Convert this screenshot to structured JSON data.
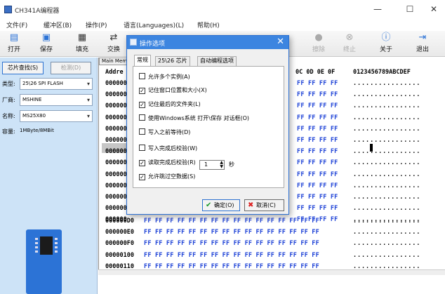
{
  "window": {
    "title": "CH341A编程器",
    "controls": [
      "—",
      "☐",
      "✕"
    ]
  },
  "menu": [
    "文件(F)",
    "缓冲区(B)",
    "操作(P)",
    "语言(Languages)(L)",
    "帮助(H)"
  ],
  "toolbar": [
    {
      "label": "打开",
      "icon": "folder-open-icon",
      "enabled": true
    },
    {
      "label": "保存",
      "icon": "save-icon",
      "enabled": true
    },
    {
      "label": "填充",
      "icon": "fill-icon",
      "enabled": true
    },
    {
      "label": "交换",
      "icon": "swap-icon",
      "enabled": true
    },
    {
      "label": "擦除",
      "icon": "erase-icon",
      "enabled": false
    },
    {
      "label": "终止",
      "icon": "stop-icon",
      "enabled": false
    },
    {
      "label": "关于",
      "icon": "info-icon",
      "enabled": true
    },
    {
      "label": "退出",
      "icon": "exit-icon",
      "enabled": true
    }
  ],
  "left": {
    "detect_button": "芯片查找(S)",
    "check_button": "检测(D)",
    "type_label": "类型:",
    "type_value": "25\\26 SPI FLASH",
    "vendor_label": "厂商:",
    "vendor_value": "MSHINE",
    "name_label": "名称:",
    "name_value": "MS25X80",
    "capacity_label": "容量:",
    "capacity_value": "1MByte/8MBit"
  },
  "hex": {
    "tab": "Main Memo",
    "addr_header": "Addre",
    "col_header": "0C 0D 0E 0F",
    "ascii_header": "0123456789ABCDEF",
    "rows_top": [
      {
        "addr": "000000",
        "bytes": "FF FF FF FF",
        "ascii": "................"
      },
      {
        "addr": "000000",
        "bytes": "FF FF FF FF",
        "ascii": "................"
      },
      {
        "addr": "000000",
        "bytes": "FF FF FF FF",
        "ascii": "................"
      },
      {
        "addr": "000000",
        "bytes": "FF FF FF FF",
        "ascii": "................"
      },
      {
        "addr": "000000",
        "bytes": "FF FF FF FF",
        "ascii": "................"
      },
      {
        "addr": "000000",
        "bytes": "FF FF FF FF",
        "ascii": "................"
      },
      {
        "addr": "000000",
        "bytes": "FF FF FF FF",
        "ascii": "................"
      },
      {
        "addr": "000000",
        "bytes": "FF FF FF FF",
        "ascii": "................"
      },
      {
        "addr": "000000",
        "bytes": "FF FF FF FF",
        "ascii": "................"
      },
      {
        "addr": "000000",
        "bytes": "FF FF FF FF",
        "ascii": "................"
      },
      {
        "addr": "000000",
        "bytes": "FF FF FF FF",
        "ascii": "................"
      },
      {
        "addr": "000000",
        "bytes": "FF FF FF FF",
        "ascii": "................"
      },
      {
        "addr": "000000",
        "bytes": "FF FF FF FF",
        "ascii": "................"
      }
    ],
    "rows_bottom": [
      {
        "addr": "000000D0",
        "bytes": "FF FF FF FF FF FF FF FF FF FF FF FF FF FF FF FF",
        "ascii": "................"
      },
      {
        "addr": "000000E0",
        "bytes": "FF FF FF FF FF FF FF FF FF FF FF FF FF FF FF FF",
        "ascii": "................"
      },
      {
        "addr": "000000F0",
        "bytes": "FF FF FF FF FF FF FF FF FF FF FF FF FF FF FF FF",
        "ascii": "................"
      },
      {
        "addr": "00000100",
        "bytes": "FF FF FF FF FF FF FF FF FF FF FF FF FF FF FF FF",
        "ascii": "................"
      },
      {
        "addr": "00000110",
        "bytes": "FF FF FF FF FF FF FF FF FF FF FF FF FF FF FF FF",
        "ascii": "................"
      }
    ]
  },
  "dialog": {
    "title": "操作选项",
    "close": "✕",
    "tabs": [
      "常规",
      "25\\26 芯片",
      "自动编程选项"
    ],
    "options": [
      {
        "label": "允许多个实例(A)",
        "checked": false
      },
      {
        "label": "记住窗口位置和大小(X)",
        "checked": true
      },
      {
        "label": "记住最后的文件夹(L)",
        "checked": true
      },
      {
        "label": "使用Windows系统 打开\\保存 对话框(O)",
        "checked": false
      },
      {
        "label": "写入之前等待(D)",
        "checked": false
      },
      {
        "label": "写入完成后校验(W)",
        "checked": false
      },
      {
        "label": "读取完成后校验(R)",
        "checked": true
      },
      {
        "label": "允许跳过空数据(S)",
        "checked": true
      }
    ],
    "wait_value": "1",
    "wait_unit": "秒",
    "ok": "确定(O)",
    "cancel": "取消(C)"
  },
  "colors": {
    "accent": "#3c85e0",
    "hex_blue": "#1a3fd6",
    "panel": "#cde3f7",
    "chip": "#2c73d6"
  }
}
